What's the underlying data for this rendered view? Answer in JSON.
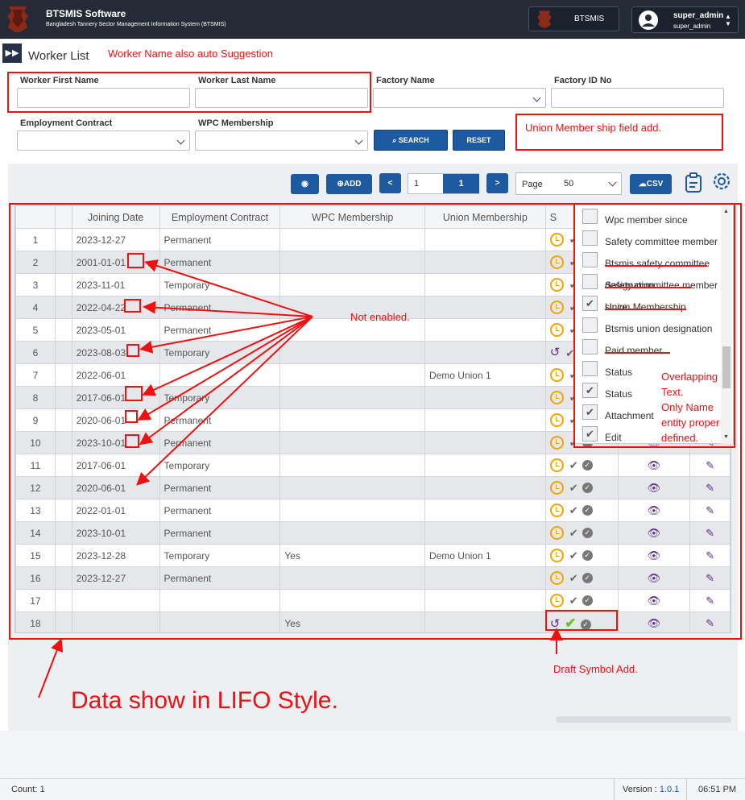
{
  "app": {
    "name": "BTSMIS Software",
    "subtitle": "Bangladesh Tannery Sector Management Information System (BTSMIS)",
    "module_button": "BTSMIS"
  },
  "user": {
    "name": "super_admin",
    "role": "super_admin"
  },
  "page": {
    "title": "Worker List",
    "expand_icon": "double-chevron-right-icon"
  },
  "filters": {
    "first_name_label": "Worker First Name",
    "last_name_label": "Worker Last Name",
    "factory_label": "Factory Name",
    "factory_id_label": "Factory ID No",
    "contract_label": "Employment Contract",
    "wpc_label": "WPC Membership",
    "search_label": "SEARCH",
    "reset_label": "RESET"
  },
  "toolbar": {
    "add_label": "ADD",
    "prev_label": "<",
    "next_label": ">",
    "page_input": "1",
    "current_page": "1",
    "page_size_label": "Page",
    "page_size": "50",
    "csv_label": "CSV"
  },
  "table": {
    "headers": [
      "",
      "",
      "Joining Date",
      "Employment Contract",
      "WPC Membership",
      "Union Membership",
      "S",
      "",
      ""
    ],
    "rows": [
      {
        "n": "1",
        "date": "2023-12-27",
        "contract": "Permanent",
        "wpc": "",
        "union": ""
      },
      {
        "n": "2",
        "date": "2001-01-01",
        "contract": "Permanent",
        "wpc": "",
        "union": ""
      },
      {
        "n": "3",
        "date": "2023-11-01",
        "contract": "Temporary",
        "wpc": "",
        "union": ""
      },
      {
        "n": "4",
        "date": "2022-04-22",
        "contract": "Permanent",
        "wpc": "",
        "union": ""
      },
      {
        "n": "5",
        "date": "2023-05-01",
        "contract": "Permanent",
        "wpc": "",
        "union": ""
      },
      {
        "n": "6",
        "date": "2023-08-03",
        "contract": "Temporary",
        "wpc": "",
        "union": ""
      },
      {
        "n": "7",
        "date": "2022-06-01",
        "contract": "",
        "wpc": "",
        "union": "Demo Union 1"
      },
      {
        "n": "8",
        "date": "2017-06-01",
        "contract": "Temporary",
        "wpc": "",
        "union": ""
      },
      {
        "n": "9",
        "date": "2020-06-01",
        "contract": "Permanent",
        "wpc": "",
        "union": ""
      },
      {
        "n": "10",
        "date": "2023-10-01",
        "contract": "Permanent",
        "wpc": "",
        "union": ""
      },
      {
        "n": "11",
        "date": "2017-06-01",
        "contract": "Temporary",
        "wpc": "",
        "union": ""
      },
      {
        "n": "12",
        "date": "2020-06-01",
        "contract": "Permanent",
        "wpc": "",
        "union": ""
      },
      {
        "n": "13",
        "date": "2022-01-01",
        "contract": "Permanent",
        "wpc": "",
        "union": ""
      },
      {
        "n": "14",
        "date": "2023-10-01",
        "contract": "Permanent",
        "wpc": "",
        "union": ""
      },
      {
        "n": "15",
        "date": "2023-12-28",
        "contract": "Temporary",
        "wpc": "Yes",
        "union": "Demo Union 1"
      },
      {
        "n": "16",
        "date": "2023-12-27",
        "contract": "Permanent",
        "wpc": "",
        "union": ""
      },
      {
        "n": "17",
        "date": "",
        "contract": "",
        "wpc": "",
        "union": ""
      },
      {
        "n": "18",
        "date": "",
        "contract": "",
        "wpc": "Yes",
        "union": ""
      }
    ]
  },
  "column_menu": [
    {
      "label": "Wpc member since",
      "checked": false
    },
    {
      "label": "Safety committee member",
      "checked": false
    },
    {
      "label": "Btsmis safety committee designation",
      "checked": false
    },
    {
      "label": "Safety committee member since",
      "checked": false
    },
    {
      "label": "Union Membership",
      "checked": true
    },
    {
      "label": "Btsmis union designation",
      "checked": false
    },
    {
      "label": "Paid member",
      "checked": false
    },
    {
      "label": "Status",
      "checked": false
    },
    {
      "label": "Status",
      "checked": true
    },
    {
      "label": "Attachment",
      "checked": true
    },
    {
      "label": "Edit",
      "checked": true
    }
  ],
  "annotations": {
    "auto_suggest": "Worker Name also auto Suggestion",
    "union_field": "Union Member ship  field add.",
    "not_enabled": "Not enabled.",
    "overlap_1": "Overlapping",
    "overlap_2": "Text.",
    "overlap_3": "Only Name",
    "overlap_4": "entity proper",
    "overlap_5": "defined.",
    "draft": "Draft Symbol Add.",
    "lifo": "Data show in LIFO Style."
  },
  "footer": {
    "count": "Count: 1",
    "version_label": "Version : ",
    "version": "1.0.1",
    "time": "06:51 PM"
  },
  "colors": {
    "header": "#252b36",
    "primary": "#1d5aa0",
    "annotation": "#e11111",
    "clock": "#f2a400",
    "purple": "#5e2d87"
  }
}
